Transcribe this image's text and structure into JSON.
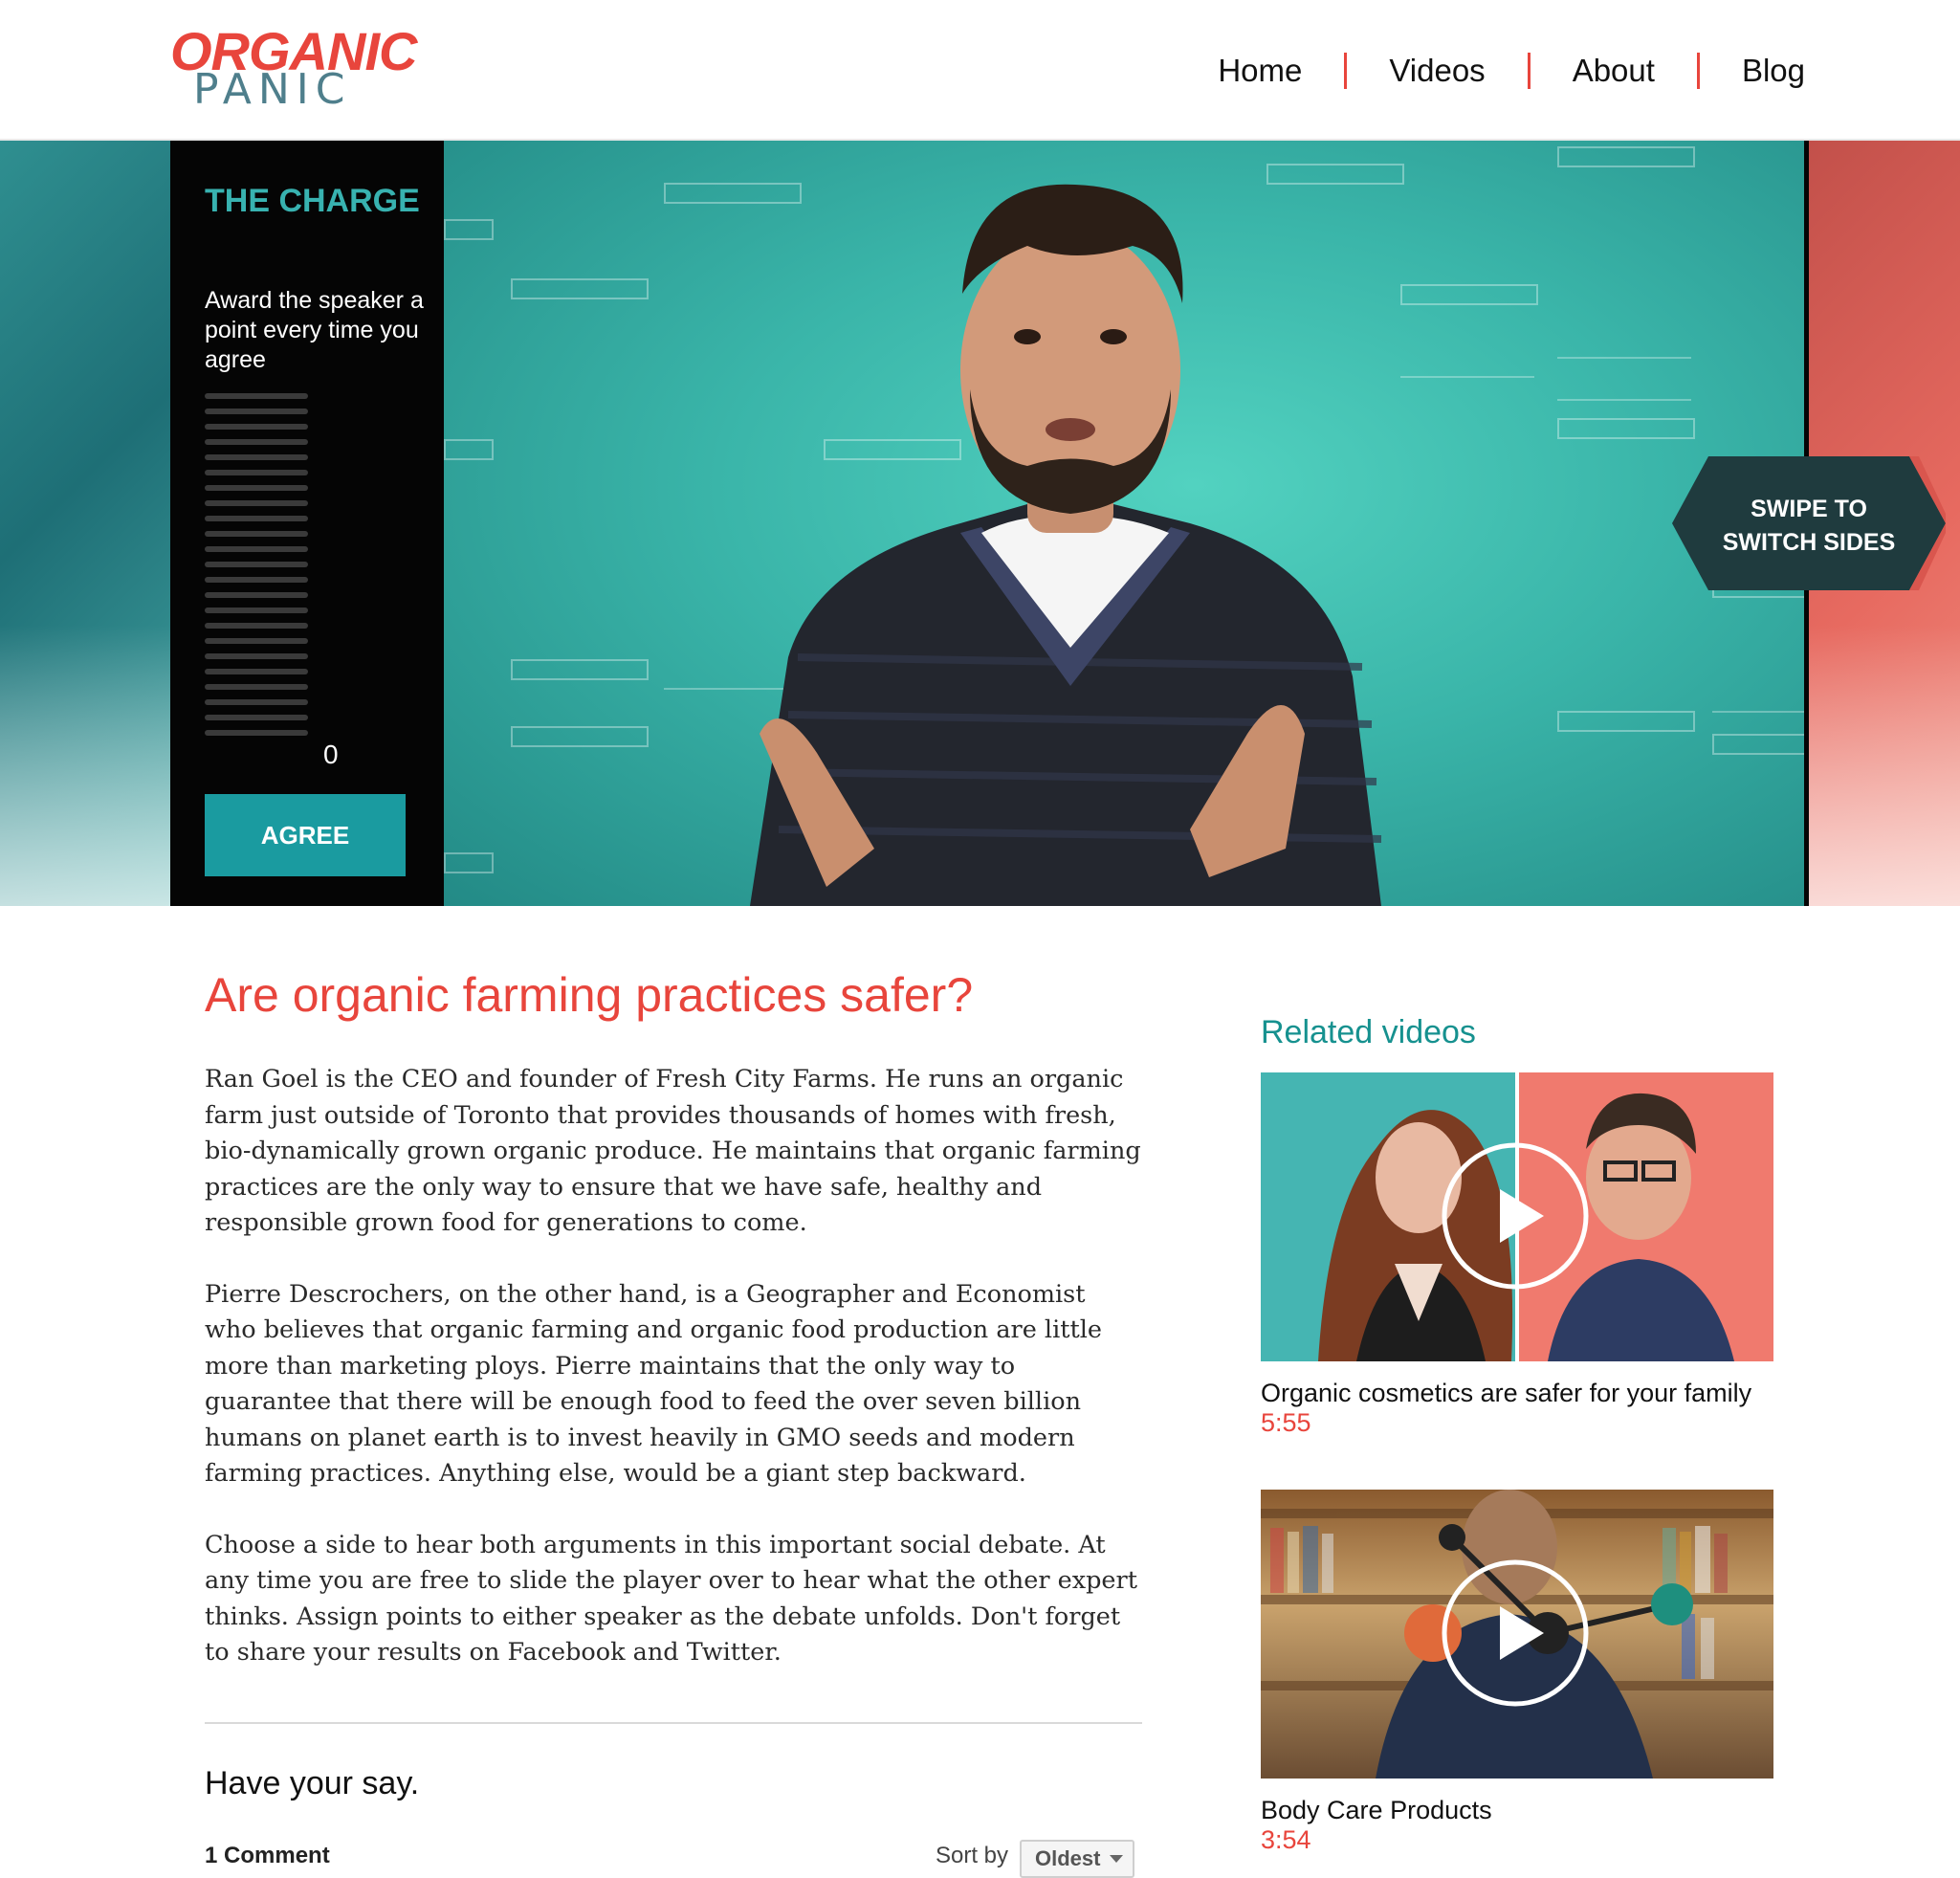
{
  "header": {
    "logo_top": "ORGANIC",
    "logo_bottom": "PANIC",
    "nav": [
      "Home",
      "Videos",
      "About",
      "Blog"
    ]
  },
  "hero": {
    "panel_title": "THE CHARGE",
    "panel_text": "Award the speaker a point every time you agree",
    "score": "0",
    "agree_label": "AGREE",
    "swipe_label_line1": "SWIPE TO",
    "swipe_label_line2": "SWITCH SIDES"
  },
  "article": {
    "title": "Are organic farming practices safer?",
    "paragraphs": [
      "Ran Goel is the CEO and founder of Fresh City Farms.  He runs an organic farm just outside of Toronto that provides thousands of homes with fresh, bio-dynamically grown organic produce.  He maintains that organic farming practices are the only way to ensure that we have safe, healthy and responsible grown food for generations to come.",
      "Pierre Descrochers, on the other hand, is a Geographer and Economist who believes that organic farming and organic food production are little more than marketing ploys. Pierre maintains that the only way to guarantee that there will be enough food to feed the over seven billion humans on planet earth is to invest heavily in GMO seeds and modern farming practices.  Anything else, would be a giant step backward.",
      "Choose a side to hear both arguments in this important social debate.  At any time you are free to slide the player over to hear what the other expert thinks. Assign points to either speaker as the debate unfolds. Don't forget to share your results on Facebook and Twitter."
    ]
  },
  "comments": {
    "heading": "Have your say.",
    "count_label": "1 Comment",
    "sort_label": "Sort by",
    "sort_value": "Oldest"
  },
  "related": {
    "heading": "Related videos",
    "videos": [
      {
        "title": "Organic cosmetics are safer for your family",
        "duration": "5:55"
      },
      {
        "title": "Body Care Products",
        "duration": "3:54"
      }
    ]
  },
  "colors": {
    "accent_red": "#e8453c",
    "accent_teal": "#1a9ba0"
  }
}
